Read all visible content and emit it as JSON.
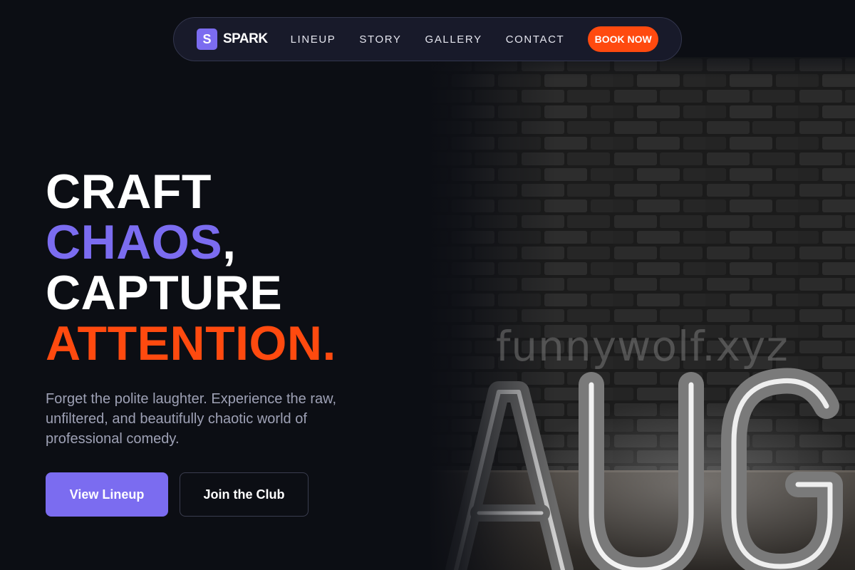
{
  "nav": {
    "brand_mark": "S",
    "brand_name": "SPARK",
    "links": [
      {
        "label": "LINEUP"
      },
      {
        "label": "STORY"
      },
      {
        "label": "GALLERY"
      },
      {
        "label": "CONTACT"
      }
    ],
    "cta_label": "BOOK NOW"
  },
  "hero": {
    "headline": {
      "line1": "CRAFT",
      "line2_accent": "CHAOS",
      "line2_punct": ",",
      "line3": "CAPTURE",
      "line4_accent": "ATTENTION."
    },
    "subtitle": "Forget the polite laughter. Experience the raw, unfiltered, and beautifully chaotic world of professional comedy.",
    "primary_button": "View Lineup",
    "secondary_button": "Join the Club",
    "image": {
      "description_icon": "neon-sign-photo",
      "watermark": "funnywolf.xyz"
    }
  },
  "colors": {
    "background": "#0c0e14",
    "accent_purple": "#7b6cf0",
    "accent_orange": "#ff4a0f",
    "nav_bg": "#181a2a",
    "muted_text": "#9ea1b5"
  }
}
